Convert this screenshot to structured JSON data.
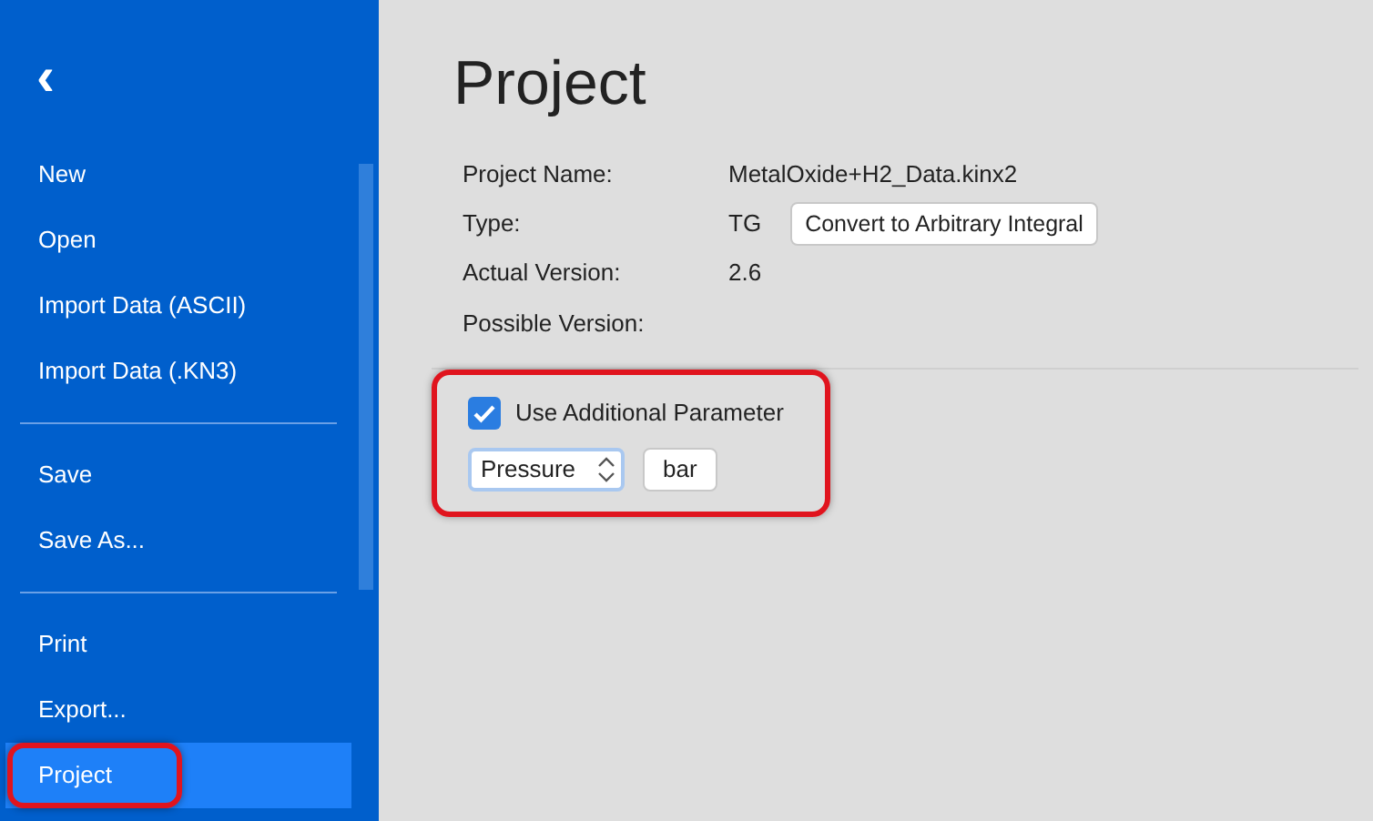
{
  "sidebar": {
    "back": "‹",
    "items": [
      {
        "kind": "item",
        "label": "New",
        "selected": false,
        "highlighted": false
      },
      {
        "kind": "item",
        "label": "Open",
        "selected": false,
        "highlighted": false
      },
      {
        "kind": "item",
        "label": "Import Data (ASCII)",
        "selected": false,
        "highlighted": false
      },
      {
        "kind": "item",
        "label": "Import Data (.KN3)",
        "selected": false,
        "highlighted": false
      },
      {
        "kind": "divider"
      },
      {
        "kind": "item",
        "label": "Save",
        "selected": false,
        "highlighted": false
      },
      {
        "kind": "item",
        "label": "Save As...",
        "selected": false,
        "highlighted": false
      },
      {
        "kind": "divider"
      },
      {
        "kind": "item",
        "label": "Print",
        "selected": false,
        "highlighted": false
      },
      {
        "kind": "item",
        "label": "Export...",
        "selected": false,
        "highlighted": false
      },
      {
        "kind": "item",
        "label": "Project",
        "selected": true,
        "highlighted": true
      }
    ]
  },
  "main": {
    "title": "Project",
    "fields": [
      {
        "label": "Project Name:",
        "value": "MetalOxide+H2_Data.kinx2"
      },
      {
        "label": "Type:",
        "value": "TG",
        "button": "Convert to Arbitrary Integral"
      },
      {
        "label": "Actual Version:",
        "value": "2.6"
      },
      {
        "label": "Possible Version:"
      }
    ],
    "parameter": {
      "highlighted": true,
      "checkbox": {
        "label": "Use Additional Parameter",
        "checked": true
      },
      "select": {
        "value": "Pressure"
      },
      "unit_button": "bar"
    }
  }
}
